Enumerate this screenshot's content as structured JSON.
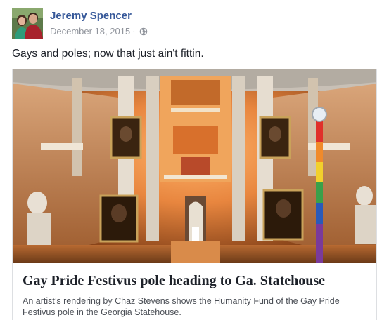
{
  "post": {
    "author": "Jeremy Spencer",
    "date": "December 18, 2015",
    "separator": "·",
    "privacy_icon": "globe-icon",
    "text": "Gays and poles; now that just ain't fittin."
  },
  "link_preview": {
    "image_desc_icon": "statehouse-rotunda-photo",
    "headline": "Gay Pride Festivus pole heading to Ga. Statehouse",
    "description": "An artist’s rendering by Chaz Stevens shows the Humanity Fund of the Gay Pride Festivus pole in the Georgia Statehouse."
  },
  "colors": {
    "author_link": "#365899",
    "meta_gray": "#90949c",
    "body_text": "#1d2129",
    "card_border": "#dddfe2"
  }
}
